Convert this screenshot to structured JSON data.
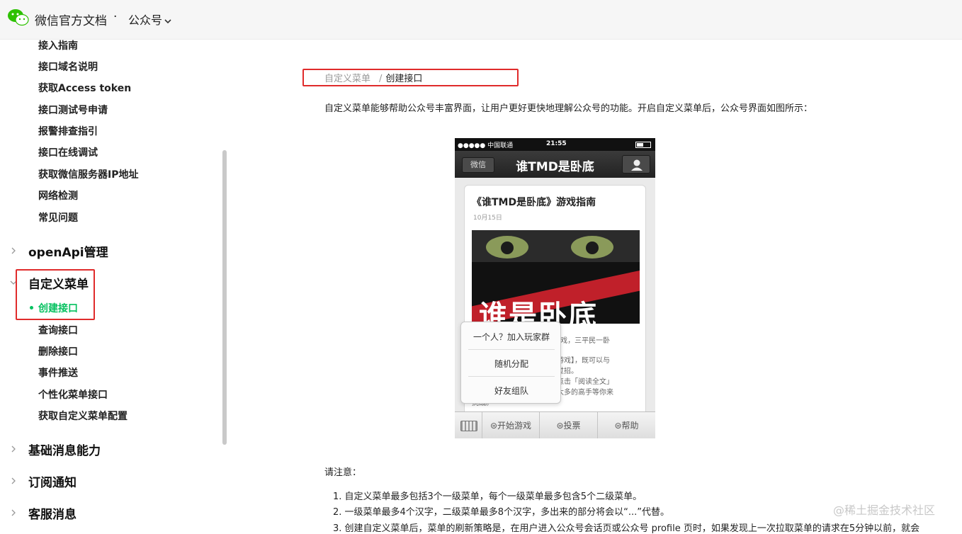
{
  "header": {
    "brand": "微信官方文档",
    "separator": "·",
    "product": "公众号"
  },
  "sidebar": {
    "sub_items_top": [
      "接入指南",
      "接口域名说明",
      "获取Access token",
      "接口测试号申请",
      "报警排查指引",
      "接口在线调试",
      "获取微信服务器IP地址",
      "网络检测",
      "常见问题"
    ],
    "groups": {
      "openapi": "openApi管理",
      "custom_menu": "自定义菜单",
      "basic_msg": "基础消息能力",
      "subscribe": "订阅通知",
      "customer_service": "客服消息"
    },
    "custom_menu_items": [
      "创建接口",
      "查询接口",
      "删除接口",
      "事件推送",
      "个性化菜单接口",
      "获取自定义菜单配置"
    ],
    "active_item": "创建接口"
  },
  "breadcrumb": {
    "parent": "自定义菜单",
    "separator": "/",
    "current": "创建接口"
  },
  "content": {
    "intro": "自定义菜单能够帮助公众号丰富界面，让用户更好更快地理解公众号的功能。开启自定义菜单后，公众号界面如图所示：",
    "notice_title": "请注意：",
    "rules": [
      "1. 自定义菜单最多包括3个一级菜单，每个一级菜单最多包含5个二级菜单。",
      "2. 一级菜单最多4个汉字，二级菜单最多8个汉字，多出来的部分将会以“...”代替。",
      "3. 创建自定义菜单后，菜单的刷新策略是，在用户进入公众号会话页或公众号 profile 页时，如果发现上一次拉取菜单的请求在5分钟以前，就会"
    ]
  },
  "phone": {
    "carrier": "●●●●● 中国联通",
    "time": "21:55",
    "back": "微信",
    "title": "谁TMD是卧底",
    "article_title": "《谁TMD是卧底》游戏指南",
    "article_date": "10月15日",
    "poster_text": "谁是卧底",
    "body_lines": [
      "”游戏，三平民一卧",
      "始游戏】，既可以与",
      "人过招。",
      "以点击「阅读全文」",
      "有太多的高手等你来",
      "挑战。"
    ],
    "popup_items": [
      "一个人？加入玩家群",
      "随机分配",
      "好友组队"
    ],
    "menu_buttons": [
      "⊜开始游戏",
      "⊜投票",
      "⊜帮助"
    ]
  },
  "watermark": "@稀土掘金技术社区",
  "colors": {
    "accent": "#07c160",
    "highlight_box": "#e02b2b"
  }
}
